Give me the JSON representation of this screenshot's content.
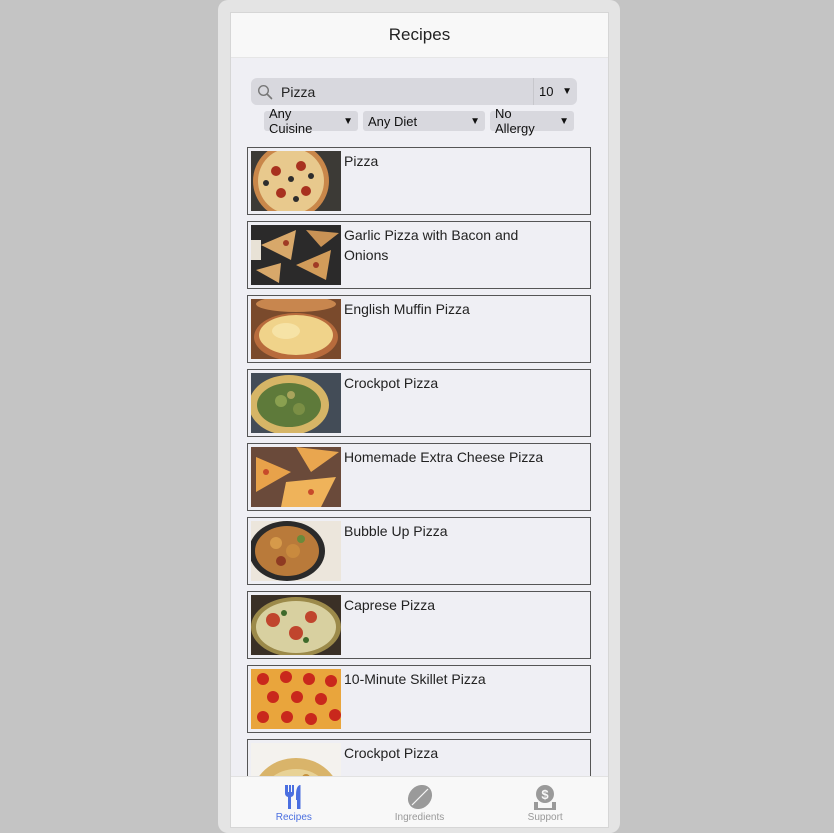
{
  "header": {
    "title": "Recipes"
  },
  "search": {
    "value": "Pizza",
    "placeholder": "Search",
    "count": "10"
  },
  "filters": {
    "cuisine": "Any Cuisine",
    "diet": "Any Diet",
    "allergy": "No Allergy"
  },
  "recipes": [
    {
      "title": "Pizza",
      "image": "pizza-photo"
    },
    {
      "title": "Garlic Pizza with Bacon and Onions",
      "image": "pizza-photo"
    },
    {
      "title": "English Muffin Pizza",
      "image": "pizza-photo"
    },
    {
      "title": "Crockpot Pizza",
      "image": "pizza-photo"
    },
    {
      "title": "Homemade Extra Cheese Pizza",
      "image": "pizza-photo"
    },
    {
      "title": "Bubble Up Pizza",
      "image": "pizza-photo"
    },
    {
      "title": "Caprese Pizza",
      "image": "pizza-photo"
    },
    {
      "title": "10-Minute Skillet Pizza",
      "image": "pizza-photo"
    },
    {
      "title": "Crockpot Pizza",
      "image": "pizza-photo"
    }
  ],
  "tabbar": {
    "items": [
      {
        "label": "Recipes",
        "icon": "fork-knife-icon",
        "active": true
      },
      {
        "label": "Ingredients",
        "icon": "leaf-icon",
        "active": false
      },
      {
        "label": "Support",
        "icon": "dollar-hand-icon",
        "active": false
      }
    ]
  },
  "colors": {
    "accent": "#4b6fe0",
    "inactive": "#999999",
    "background": "#efeff4"
  }
}
